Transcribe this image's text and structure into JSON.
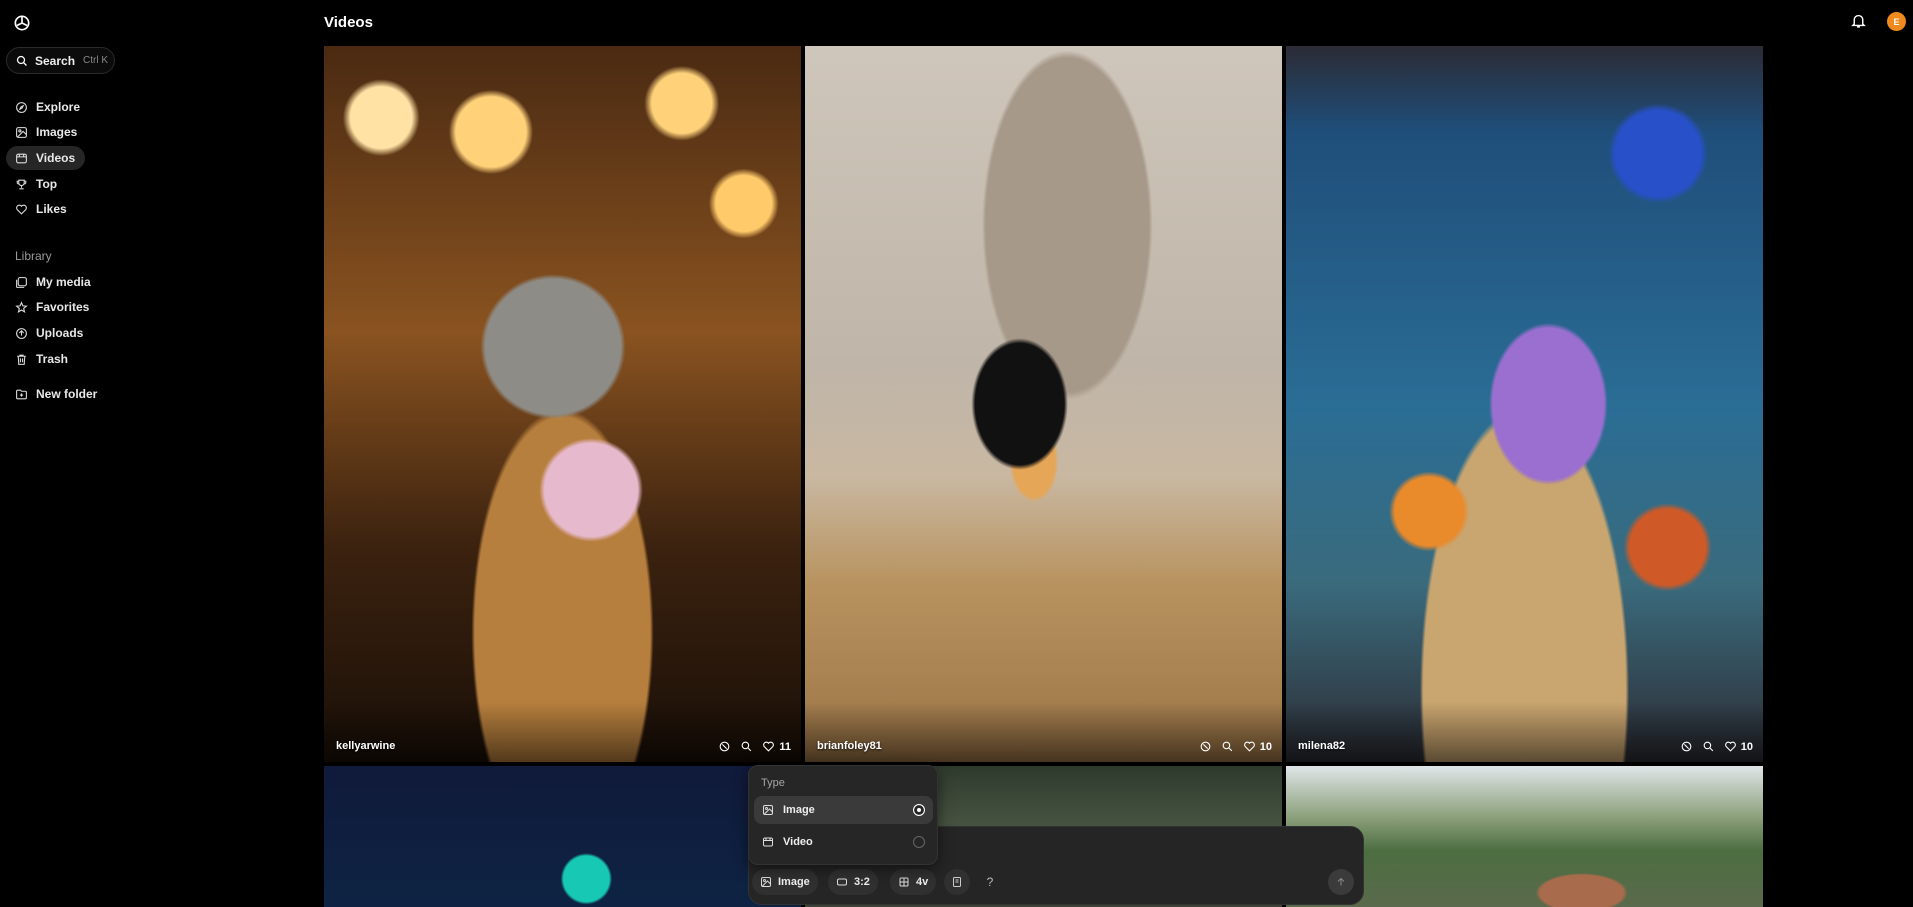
{
  "sidebar": {
    "search": {
      "label": "Search",
      "shortcut": "Ctrl K"
    },
    "nav": [
      {
        "label": "Explore",
        "icon": "compass-icon"
      },
      {
        "label": "Images",
        "icon": "image-icon"
      },
      {
        "label": "Videos",
        "icon": "video-icon",
        "active": true
      },
      {
        "label": "Top",
        "icon": "trophy-icon"
      },
      {
        "label": "Likes",
        "icon": "heart-icon"
      }
    ],
    "library_label": "Library",
    "library": [
      {
        "label": "My media",
        "icon": "media-icon"
      },
      {
        "label": "Favorites",
        "icon": "star-icon"
      },
      {
        "label": "Uploads",
        "icon": "upload-icon"
      },
      {
        "label": "Trash",
        "icon": "trash-icon"
      }
    ],
    "new_folder": "New folder"
  },
  "header": {
    "title": "Videos",
    "avatar_initial": "E"
  },
  "grid": [
    {
      "author": "kellyarwine",
      "likes": "11"
    },
    {
      "author": "brianfoley81",
      "likes": "10"
    },
    {
      "author": "milena82",
      "likes": "10"
    }
  ],
  "composer": {
    "type_menu": {
      "header": "Type",
      "options": [
        {
          "label": "Image",
          "selected": true
        },
        {
          "label": "Video",
          "selected": false
        }
      ]
    },
    "type_button": "Image",
    "aspect_button": "3:2",
    "variations_button": "4v",
    "help": "?"
  },
  "colors": {
    "background": "#000000",
    "accent_avatar": "#f08a1c",
    "active_nav": "#262626"
  }
}
